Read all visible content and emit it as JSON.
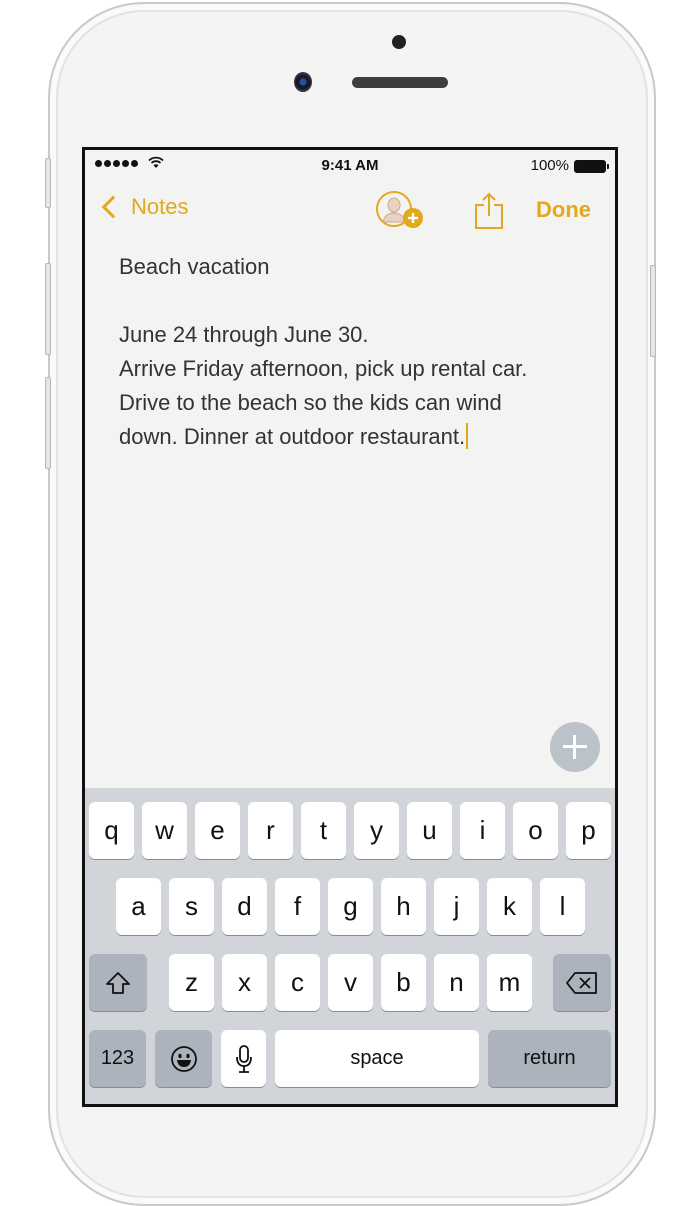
{
  "status_bar": {
    "signal_bars": 5,
    "wifi_icon": "wifi-icon",
    "time": "9:41 AM",
    "battery_percent": "100%",
    "battery_level": 1.0
  },
  "nav": {
    "back_label": "Notes",
    "add_people_icon": "add-person-icon",
    "share_icon": "share-icon",
    "done_label": "Done",
    "accent_color": "#e3a81b"
  },
  "note": {
    "title": "Beach vacation",
    "lines": [
      "June 24 through June 30.",
      "Arrive Friday afternoon, pick up rental car.",
      "Drive to the beach so the kids can wind",
      "down. Dinner at outdoor restaurant."
    ]
  },
  "fab": {
    "icon": "plus-icon"
  },
  "keyboard": {
    "row1": [
      "q",
      "w",
      "e",
      "r",
      "t",
      "y",
      "u",
      "i",
      "o",
      "p"
    ],
    "row2": [
      "a",
      "s",
      "d",
      "f",
      "g",
      "h",
      "j",
      "k",
      "l"
    ],
    "row3": [
      "z",
      "x",
      "c",
      "v",
      "b",
      "n",
      "m"
    ],
    "shift_icon": "shift-icon",
    "delete_icon": "delete-icon",
    "numbers_label": "123",
    "emoji_icon": "emoji-icon",
    "mic_icon": "microphone-icon",
    "space_label": "space",
    "return_label": "return"
  }
}
